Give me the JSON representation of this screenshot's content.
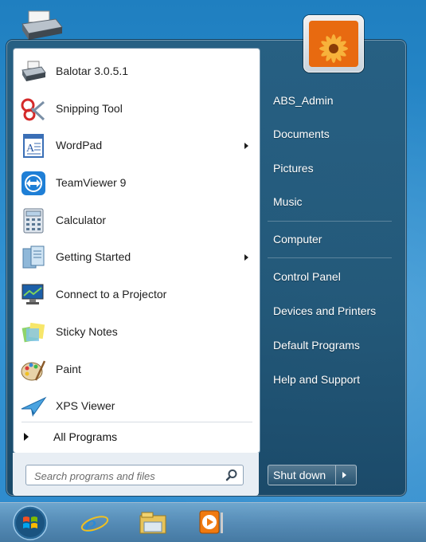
{
  "programs": [
    {
      "label": "Balotar 3.0.5.1",
      "icon": "printer-icon",
      "submenu": false
    },
    {
      "label": "Snipping Tool",
      "icon": "scissors-icon",
      "submenu": false
    },
    {
      "label": "WordPad",
      "icon": "wordpad-icon",
      "submenu": true
    },
    {
      "label": "TeamViewer 9",
      "icon": "teamviewer-icon",
      "submenu": false
    },
    {
      "label": "Calculator",
      "icon": "calculator-icon",
      "submenu": false
    },
    {
      "label": "Getting Started",
      "icon": "getting-started-icon",
      "submenu": true
    },
    {
      "label": "Connect to a Projector",
      "icon": "projector-icon",
      "submenu": false
    },
    {
      "label": "Sticky Notes",
      "icon": "sticky-notes-icon",
      "submenu": false
    },
    {
      "label": "Paint",
      "icon": "paint-palette-icon",
      "submenu": false
    },
    {
      "label": "XPS Viewer",
      "icon": "xps-viewer-icon",
      "submenu": false
    }
  ],
  "all_programs_label": "All Programs",
  "search": {
    "placeholder": "Search programs and files",
    "value": ""
  },
  "right_items": [
    {
      "label": "ABS_Admin"
    },
    {
      "label": "Documents"
    },
    {
      "label": "Pictures"
    },
    {
      "label": "Music"
    },
    {
      "label": "Computer"
    },
    {
      "label": "Control Panel"
    },
    {
      "label": "Devices and Printers"
    },
    {
      "label": "Default Programs"
    },
    {
      "label": "Help and Support"
    }
  ],
  "shutdown_label": "Shut down",
  "taskbar_icons": [
    "windows-orb-icon",
    "internet-explorer-icon",
    "file-explorer-icon",
    "media-player-icon"
  ],
  "colors": {
    "accent": "#2b86c6",
    "menu_text": "#ffffff",
    "list_text": "#1e1e1e"
  }
}
